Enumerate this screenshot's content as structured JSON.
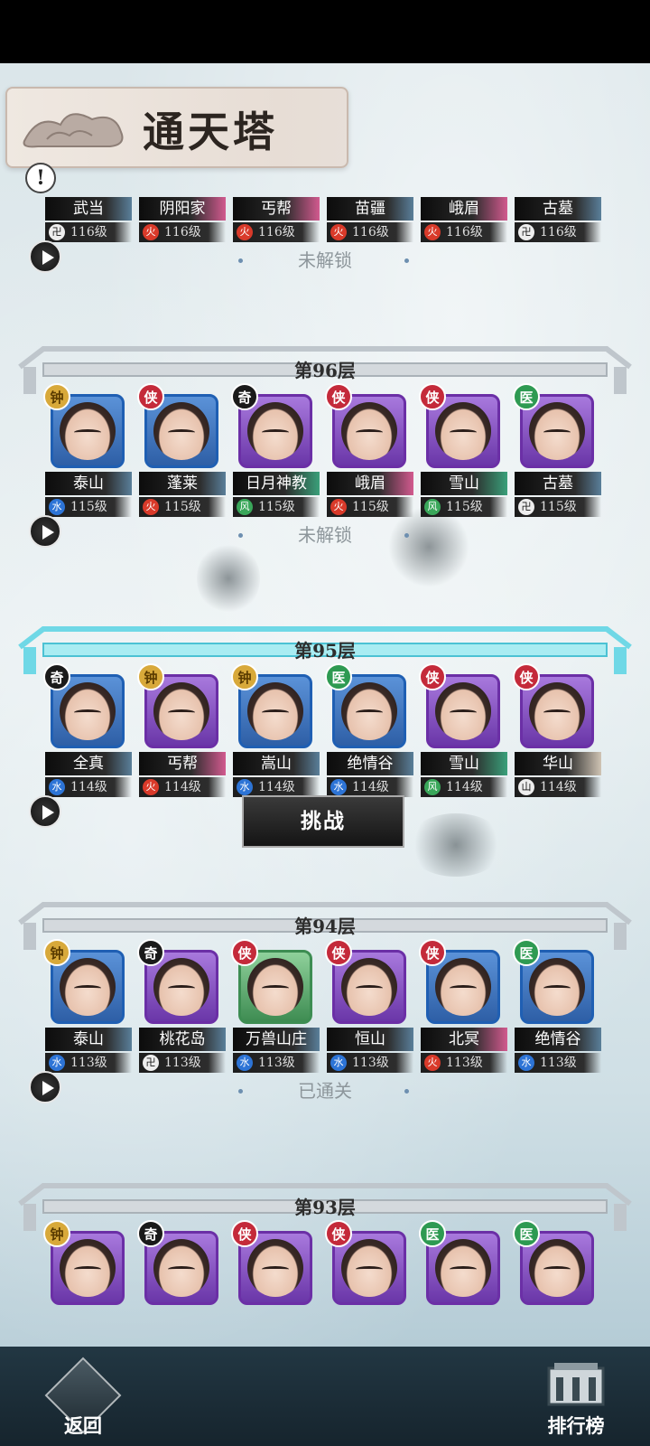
{
  "page_title": "通天塔",
  "status_locked": "未解锁",
  "status_cleared": "已通关",
  "challenge_label": "挑战",
  "bottom": {
    "back_label": "返回",
    "rank_label": "排行榜"
  },
  "floors": [
    {
      "label": "",
      "status": "未解锁",
      "warriors": [
        {
          "school": "武当",
          "level": "116级",
          "badge": "",
          "frame": "blue",
          "elem": "dark"
        },
        {
          "school": "阴阳家",
          "level": "116级",
          "badge": "",
          "frame": "purple",
          "elem": "fire"
        },
        {
          "school": "丐帮",
          "level": "116级",
          "badge": "",
          "frame": "purple",
          "elem": "fire"
        },
        {
          "school": "苗疆",
          "level": "116级",
          "badge": "",
          "frame": "blue",
          "elem": "fire"
        },
        {
          "school": "峨眉",
          "level": "116级",
          "badge": "",
          "frame": "purple",
          "elem": "fire"
        },
        {
          "school": "古墓",
          "level": "116级",
          "badge": "",
          "frame": "purple",
          "elem": "dark"
        }
      ]
    },
    {
      "label": "第96层",
      "status": "未解锁",
      "warriors": [
        {
          "school": "泰山",
          "level": "115级",
          "badge": "钟",
          "frame": "blue",
          "elem": "water"
        },
        {
          "school": "蓬莱",
          "level": "115级",
          "badge": "侠",
          "frame": "blue",
          "elem": "fire"
        },
        {
          "school": "日月神教",
          "level": "115级",
          "badge": "奇",
          "frame": "purple",
          "elem": "wind"
        },
        {
          "school": "峨眉",
          "level": "115级",
          "badge": "侠",
          "frame": "purple",
          "elem": "fire"
        },
        {
          "school": "雪山",
          "level": "115级",
          "badge": "侠",
          "frame": "purple",
          "elem": "wind"
        },
        {
          "school": "古墓",
          "level": "115级",
          "badge": "医",
          "frame": "purple",
          "elem": "dark"
        }
      ]
    },
    {
      "label": "第95层",
      "status": "",
      "warriors": [
        {
          "school": "全真",
          "level": "114级",
          "badge": "奇",
          "frame": "blue",
          "elem": "water"
        },
        {
          "school": "丐帮",
          "level": "114级",
          "badge": "钟",
          "frame": "purple",
          "elem": "fire"
        },
        {
          "school": "嵩山",
          "level": "114级",
          "badge": "钟",
          "frame": "blue",
          "elem": "water"
        },
        {
          "school": "绝情谷",
          "level": "114级",
          "badge": "医",
          "frame": "blue",
          "elem": "water"
        },
        {
          "school": "雪山",
          "level": "114级",
          "badge": "侠",
          "frame": "purple",
          "elem": "wind"
        },
        {
          "school": "华山",
          "level": "114级",
          "badge": "侠",
          "frame": "purple",
          "elem": "dark"
        }
      ]
    },
    {
      "label": "第94层",
      "status": "已通关",
      "warriors": [
        {
          "school": "泰山",
          "level": "113级",
          "badge": "钟",
          "frame": "blue",
          "elem": "water"
        },
        {
          "school": "桃花岛",
          "level": "113级",
          "badge": "奇",
          "frame": "purple",
          "elem": "dark"
        },
        {
          "school": "万兽山庄",
          "level": "113级",
          "badge": "侠",
          "frame": "green",
          "elem": "water"
        },
        {
          "school": "恒山",
          "level": "113级",
          "badge": "侠",
          "frame": "purple",
          "elem": "water"
        },
        {
          "school": "北冥",
          "level": "113级",
          "badge": "侠",
          "frame": "blue",
          "elem": "fire"
        },
        {
          "school": "绝情谷",
          "level": "113级",
          "badge": "医",
          "frame": "blue",
          "elem": "water"
        }
      ]
    },
    {
      "label": "第93层",
      "status": "",
      "warriors": [
        {
          "school": "",
          "level": "",
          "badge": "钟",
          "frame": "purple",
          "elem": ""
        },
        {
          "school": "",
          "level": "",
          "badge": "奇",
          "frame": "purple",
          "elem": ""
        },
        {
          "school": "",
          "level": "",
          "badge": "侠",
          "frame": "purple",
          "elem": ""
        },
        {
          "school": "",
          "level": "",
          "badge": "侠",
          "frame": "purple",
          "elem": ""
        },
        {
          "school": "",
          "level": "",
          "badge": "医",
          "frame": "purple",
          "elem": ""
        },
        {
          "school": "",
          "level": "",
          "badge": "医",
          "frame": "purple",
          "elem": ""
        }
      ]
    }
  ],
  "colors": {
    "frame_blue": "#1f5fb3",
    "frame_purple": "#6b2fa6",
    "frame_green": "#3d8d52",
    "active_gate": "#6fd8e6",
    "inactive_gate": "#c7cdd3"
  }
}
